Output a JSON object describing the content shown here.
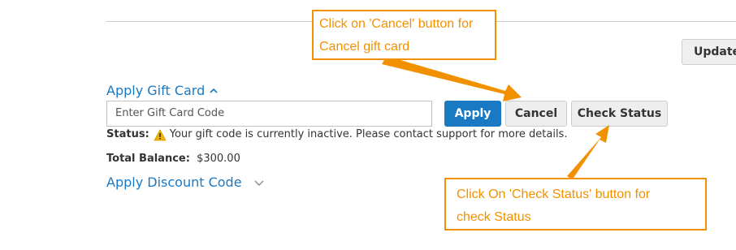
{
  "header": {
    "update_label": "Update"
  },
  "gift_card": {
    "title": "Apply Gift Card",
    "input_placeholder": "Enter Gift Card Code",
    "apply_label": "Apply",
    "cancel_label": "Cancel",
    "check_status_label": "Check Status",
    "status_label": "Status:",
    "status_text": "Your gift code is currently inactive. Please contact support for more details.",
    "balance_label": "Total Balance:",
    "balance_value": "$300.00"
  },
  "discount": {
    "title": "Apply Discount Code"
  },
  "annotations": {
    "cancel_note_line1": "Click on 'Cancel' button for",
    "cancel_note_line2": "Cancel gift card",
    "check_note_line1": "Click On 'Check Status' button for",
    "check_note_line2": "check Status"
  },
  "colors": {
    "link": "#1979c3",
    "primary_button": "#1979c3",
    "annotation": "#f29100",
    "warning": "#f0b400"
  },
  "icons": {
    "gift_toggle": "chevron-up-icon",
    "discount_toggle": "chevron-down-icon",
    "status": "warning-icon"
  }
}
